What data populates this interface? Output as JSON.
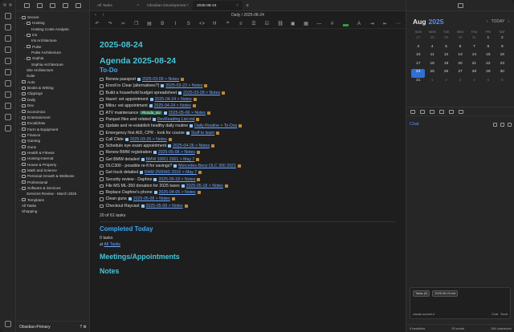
{
  "vault_name": "Obsidian-Primary",
  "tabs": [
    {
      "label": "All Tasks"
    },
    {
      "label": "Obsidian Development"
    },
    {
      "label": "2025-08-24"
    }
  ],
  "titlebar": "Daily / 2025-08-24",
  "explorer": {
    "items": [
      {
        "indent": 1,
        "label": "Secure",
        "type": "folder",
        "open": true
      },
      {
        "indent": 2,
        "label": "Hosting",
        "type": "folder",
        "open": true
      },
      {
        "indent": 3,
        "label": "Hosting Costs Analysis",
        "type": "file"
      },
      {
        "indent": 2,
        "label": "Iris",
        "type": "folder",
        "open": true
      },
      {
        "indent": 3,
        "label": "Iris Architecture",
        "type": "file"
      },
      {
        "indent": 2,
        "label": "Pulse",
        "type": "folder",
        "open": true
      },
      {
        "indent": 3,
        "label": "Pulse Architecture",
        "type": "file"
      },
      {
        "indent": 2,
        "label": "Sophia",
        "type": "folder",
        "open": true
      },
      {
        "indent": 3,
        "label": "Sophia Architecture",
        "type": "file"
      },
      {
        "indent": 2,
        "label": "Site Architecture",
        "type": "file"
      },
      {
        "indent": 2,
        "label": "Suite",
        "type": "file"
      },
      {
        "indent": 1,
        "label": "Auto",
        "type": "folder"
      },
      {
        "indent": 1,
        "label": "Books & Writing",
        "type": "folder"
      },
      {
        "indent": 1,
        "label": "Clippings",
        "type": "folder"
      },
      {
        "indent": 1,
        "label": "Daily",
        "type": "folder"
      },
      {
        "indent": 1,
        "label": "Dev",
        "type": "folder"
      },
      {
        "indent": 1,
        "label": "Economics",
        "type": "folder"
      },
      {
        "indent": 1,
        "label": "Entertainment",
        "type": "folder"
      },
      {
        "indent": 1,
        "label": "Excalidraw",
        "type": "folder"
      },
      {
        "indent": 1,
        "label": "Farm & Equipment",
        "type": "folder"
      },
      {
        "indent": 1,
        "label": "Finance",
        "type": "folder"
      },
      {
        "indent": 1,
        "label": "Gaming",
        "type": "folder"
      },
      {
        "indent": 1,
        "label": "Guns",
        "type": "folder"
      },
      {
        "indent": 1,
        "label": "Health & Fitness",
        "type": "folder"
      },
      {
        "indent": 1,
        "label": "Hosting-Internal",
        "type": "folder"
      },
      {
        "indent": 1,
        "label": "House & Property",
        "type": "folder"
      },
      {
        "indent": 1,
        "label": "Math and Science",
        "type": "folder"
      },
      {
        "indent": 1,
        "label": "Personal Growth & Wellness",
        "type": "folder"
      },
      {
        "indent": 1,
        "label": "Professional",
        "type": "folder"
      },
      {
        "indent": 1,
        "label": "Software & Services",
        "type": "folder",
        "open": true
      },
      {
        "indent": 2,
        "label": "Services Review - March 2025",
        "type": "file"
      },
      {
        "indent": 1,
        "label": "Templates",
        "type": "folder"
      },
      {
        "indent": 1,
        "label": "All Tasks",
        "type": "file"
      },
      {
        "indent": 1,
        "label": "Shopping",
        "type": "file"
      }
    ]
  },
  "note": {
    "title": "2025-08-24",
    "agenda_heading": "Agenda 2025-08-24",
    "todo_heading": "To-Do",
    "tasks": [
      {
        "text": "Renew passport",
        "date": "2025-03-09 > Notes"
      },
      {
        "text": "Enroll in Clear (alternatives?)",
        "date": "2025-03-23 > Notes"
      },
      {
        "text": "Build a household budget spreadsheet",
        "date": "2025-03-28 > Notes"
      },
      {
        "text": "Hazel: vet appointment",
        "date": "2025-04-24 > Notes"
      },
      {
        "text": "Milou: vet appointment",
        "date": "2025-04-24 > Notes"
      },
      {
        "text": "ATV maintenance",
        "tag": "#honda_atv",
        "date": "2025-05-06 > Notes"
      },
      {
        "text": "Parquet files and related",
        "link": "DevReading List.md"
      },
      {
        "text": "Update and re-establish healthy daily routine",
        "link": "Daily Routine > To-Dos"
      },
      {
        "text": "Emergency first AID, CPR - look for course",
        "link": "Stuff to learn"
      },
      {
        "text": "Call Clide",
        "date": "2025-03-25 > Notes"
      },
      {
        "text": "Schedule eye exam appointment",
        "date": "2025-04-26 > Notes"
      },
      {
        "text": "Renew BMW registration",
        "date": "2025-05-08 > Notes"
      },
      {
        "text": "Get BMW detailed",
        "link": "BMW 330Ci 2001 > May 7"
      },
      {
        "text": "OLC300 - possible re-fi for savings?",
        "link": "Mercedes-Benz OLC 300 2021"
      },
      {
        "text": "Get truck detailed",
        "link": "RAM 2500HD 2016 > May 7"
      },
      {
        "text": "Security review - Daphne",
        "date": "2025-05-18 > Notes"
      },
      {
        "text": "File MS ML-350 donation for 2025 taxes",
        "date": "2025-05-18 > Notes"
      },
      {
        "text": "Replace Daphne's phone",
        "date": "2025-04-06 > Notes"
      },
      {
        "text": "Clean guns",
        "date": "2025-05-08 > Notes"
      },
      {
        "text": "Checkout Raycast",
        "date": "2025-05-08 > Notes"
      }
    ],
    "task_summary": "20 of 61 tasks",
    "completed_heading": "Completed Today",
    "completed_count": "0 tasks",
    "all_tasks_prefix": "⇄",
    "all_tasks_link": "All Tasks",
    "meetings_heading": "Meetings/Appointments",
    "notes_heading": "Notes"
  },
  "calendar": {
    "month": "Aug",
    "year": "2025",
    "today_label": "TODAY",
    "weekdays": [
      "SUN",
      "MON",
      "TUE",
      "WED",
      "THU",
      "FRI",
      "SAT"
    ],
    "days": [
      {
        "n": "27",
        "other": true
      },
      {
        "n": "28",
        "other": true
      },
      {
        "n": "29",
        "other": true
      },
      {
        "n": "30",
        "other": true
      },
      {
        "n": "31",
        "other": true
      },
      {
        "n": "1"
      },
      {
        "n": "2"
      },
      {
        "n": "3"
      },
      {
        "n": "4"
      },
      {
        "n": "5"
      },
      {
        "n": "6"
      },
      {
        "n": "7"
      },
      {
        "n": "8"
      },
      {
        "n": "9"
      },
      {
        "n": "10"
      },
      {
        "n": "11"
      },
      {
        "n": "12"
      },
      {
        "n": "13"
      },
      {
        "n": "14"
      },
      {
        "n": "15"
      },
      {
        "n": "16"
      },
      {
        "n": "17"
      },
      {
        "n": "18"
      },
      {
        "n": "19"
      },
      {
        "n": "20"
      },
      {
        "n": "21"
      },
      {
        "n": "22"
      },
      {
        "n": "23"
      },
      {
        "n": "24",
        "today": true
      },
      {
        "n": "25"
      },
      {
        "n": "26"
      },
      {
        "n": "27"
      },
      {
        "n": "28"
      },
      {
        "n": "29"
      },
      {
        "n": "30"
      },
      {
        "n": "31"
      },
      {
        "n": "1",
        "other": true
      },
      {
        "n": "2",
        "other": true
      },
      {
        "n": "3",
        "other": true
      },
      {
        "n": "4",
        "other": true
      },
      {
        "n": "5",
        "other": true
      },
      {
        "n": "6",
        "other": true
      }
    ]
  },
  "chat": {
    "title": "Chat",
    "chips": [
      "Tasks (0)",
      "2025-08-24.md"
    ],
    "model": "claude-sonnet-4",
    "chat_label": "Chat",
    "send_label": "Send"
  },
  "status": {
    "backlinks": "0 backlinks",
    "words": "93 words",
    "chars": "284 characters"
  },
  "colors": {
    "heading": "#46c5d8",
    "subheading": "#3fa6f2",
    "link": "#6fa8ff",
    "accent": "#5b8cff"
  }
}
